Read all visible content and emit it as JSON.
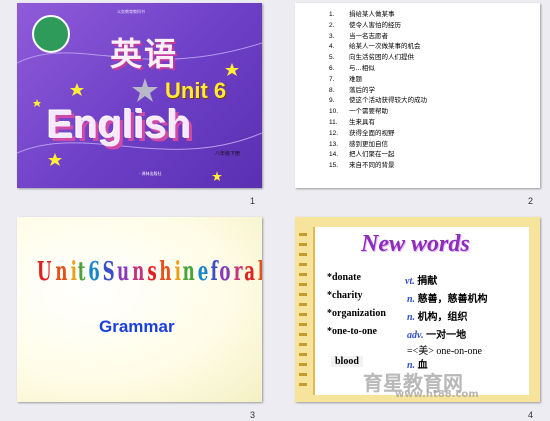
{
  "slides": {
    "s1": {
      "number": "1",
      "series_label": "义务教育教科书",
      "title_cn": "英语",
      "unit": "Unit 6",
      "english": "English",
      "grade": "八年级下册",
      "publisher": "·  译林出版社"
    },
    "s2": {
      "number": "2",
      "items": [
        {
          "n": "1.",
          "text": "捐给某人做某事"
        },
        {
          "n": "2.",
          "text": "使令人害怕的经历"
        },
        {
          "n": "3.",
          "text": "当一名志愿者"
        },
        {
          "n": "4.",
          "text": "给某人一次做某事的机会"
        },
        {
          "n": "5.",
          "text": "向生活贫困的人们提供"
        },
        {
          "n": "6.",
          "text": "与...相似"
        },
        {
          "n": "7.",
          "text": "难题"
        },
        {
          "n": "8.",
          "text": "落后的学"
        },
        {
          "n": "9.",
          "text": "使这个活动获得较大的成功"
        },
        {
          "n": "10.",
          "text": "一个需要帮助"
        },
        {
          "n": "11.",
          "text": "生来具有"
        },
        {
          "n": "12.",
          "text": "获得全面的视野"
        },
        {
          "n": "13.",
          "text": "感到更加自信"
        },
        {
          "n": "14.",
          "text": "把人们聚在一起"
        },
        {
          "n": "15.",
          "text": "来自不同的背景"
        }
      ]
    },
    "s3": {
      "number": "3",
      "title": "Unit 6 Sunshine for all",
      "subtitle": "Grammar"
    },
    "s4": {
      "number": "4",
      "heading": "New words",
      "words": [
        {
          "word": "*donate",
          "pos": "vt.",
          "meaning": "捐献"
        },
        {
          "word": "*charity",
          "pos": "n.",
          "meaning": "慈善，慈善机构"
        },
        {
          "word": "*organization",
          "pos": "n.",
          "meaning": "机构，组织"
        },
        {
          "word": "*one-to-one",
          "pos": "adv.",
          "meaning": "一对一地"
        }
      ],
      "us_note": "=<美> one-on-one",
      "blood_word": "blood",
      "blood_pos": "n.",
      "blood_meaning": "血",
      "watermark_cn": "育星教育网",
      "watermark_url": "www.ht88.com"
    }
  },
  "colors": {
    "slide1_bg": "#7a49cf",
    "unit_yellow": "#ffe93a",
    "grammar_blue": "#1a3fe0",
    "new_words_purple": "#8b2fb8",
    "pos_blue": "#3050c8"
  }
}
